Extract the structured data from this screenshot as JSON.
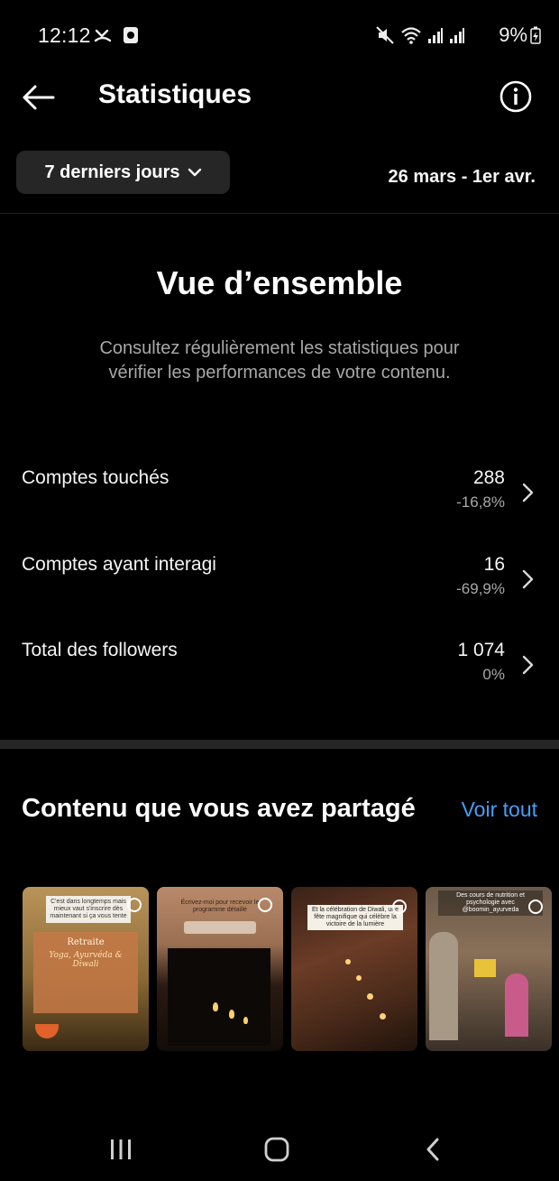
{
  "status_bar": {
    "time": "12:12",
    "battery": "9%"
  },
  "header": {
    "title": "Statistiques"
  },
  "filters": {
    "period": "7 derniers jours",
    "date_range": "26 mars - 1er avr."
  },
  "overview": {
    "title": "Vue d’ensemble",
    "subtitle": "Consultez régulièrement les statistiques pour vérifier les performances de votre contenu."
  },
  "metrics": [
    {
      "label": "Comptes touchés",
      "value": "288",
      "change": "-16,8%"
    },
    {
      "label": "Comptes ayant interagi",
      "value": "16",
      "change": "-69,9%"
    },
    {
      "label": "Total des followers",
      "value": "1 074",
      "change": "0%"
    }
  ],
  "shared_content": {
    "title": "Contenu que vous avez partagé",
    "see_all": "Voir tout",
    "thumbnails": [
      {
        "caption": "C'est dans longtemps mais mieux vaut s'inscrire dès maintenant si ça vous tente",
        "line2": "Retraite",
        "line3": "Yoga, Ayurvéda & Diwali"
      },
      {
        "caption": "Écrivez-moi pour recevoir le programme détaillé"
      },
      {
        "caption": "Et la célébration de Diwali, une fête magnifique qui célèbre la victoire de la lumière"
      },
      {
        "caption": "Des cours de nutrition et psychologie avec @boomin_ayurveda"
      }
    ]
  },
  "colors": {
    "background": "#000000",
    "accent_link": "#4a9df8",
    "muted_text": "#a8a8a8",
    "chip_bg": "#262626"
  }
}
